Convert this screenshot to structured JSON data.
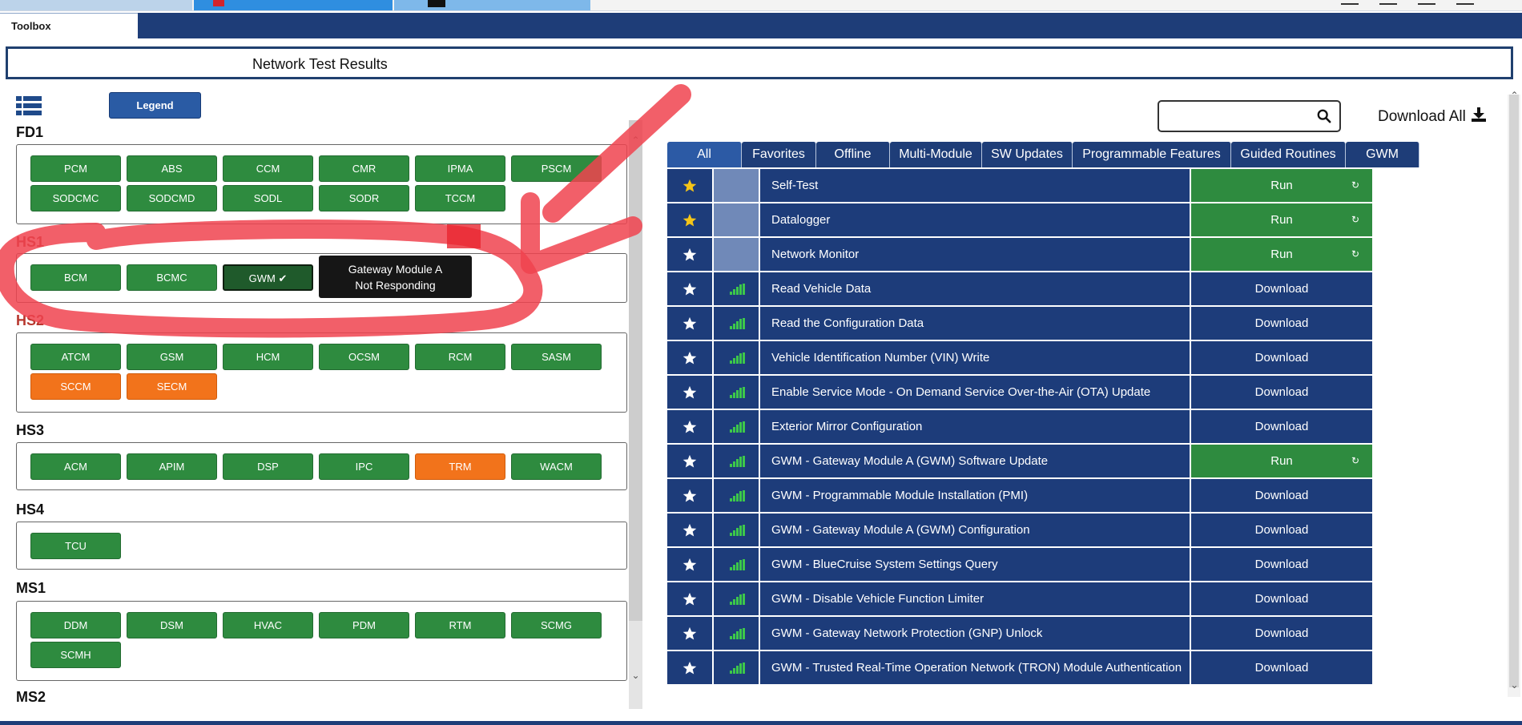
{
  "toolbar": {
    "tab_label": "Toolbox"
  },
  "title": "Network Test Results",
  "legend_button": "Legend",
  "groups": [
    {
      "label": "FD1",
      "modules": [
        {
          "name": "PCM",
          "status": "green"
        },
        {
          "name": "ABS",
          "status": "green"
        },
        {
          "name": "CCM",
          "status": "green"
        },
        {
          "name": "CMR",
          "status": "green"
        },
        {
          "name": "IPMA",
          "status": "green"
        },
        {
          "name": "PSCM",
          "status": "green"
        },
        {
          "name": "SODCMC",
          "status": "green"
        },
        {
          "name": "SODCMD",
          "status": "green"
        },
        {
          "name": "SODL",
          "status": "green"
        },
        {
          "name": "SODR",
          "status": "green"
        },
        {
          "name": "TCCM",
          "status": "green"
        }
      ]
    },
    {
      "label": "HS1",
      "modules": [
        {
          "name": "BCM",
          "status": "green"
        },
        {
          "name": "BCMC",
          "status": "green"
        },
        {
          "name": "GWM",
          "status": "selected"
        }
      ]
    },
    {
      "label": "HS2",
      "modules": [
        {
          "name": "ATCM",
          "status": "green"
        },
        {
          "name": "GSM",
          "status": "green"
        },
        {
          "name": "HCM",
          "status": "green"
        },
        {
          "name": "OCSM",
          "status": "green"
        },
        {
          "name": "RCM",
          "status": "green"
        },
        {
          "name": "SASM",
          "status": "green"
        },
        {
          "name": "SCCM",
          "status": "orange"
        },
        {
          "name": "SECM",
          "status": "orange"
        }
      ]
    },
    {
      "label": "HS3",
      "modules": [
        {
          "name": "ACM",
          "status": "green"
        },
        {
          "name": "APIM",
          "status": "green"
        },
        {
          "name": "DSP",
          "status": "green"
        },
        {
          "name": "IPC",
          "status": "green"
        },
        {
          "name": "TRM",
          "status": "orange"
        },
        {
          "name": "WACM",
          "status": "green"
        }
      ]
    },
    {
      "label": "HS4",
      "modules": [
        {
          "name": "TCU",
          "status": "green"
        }
      ]
    },
    {
      "label": "MS1",
      "modules": [
        {
          "name": "DDM",
          "status": "green"
        },
        {
          "name": "DSM",
          "status": "green"
        },
        {
          "name": "HVAC",
          "status": "green"
        },
        {
          "name": "PDM",
          "status": "green"
        },
        {
          "name": "RTM",
          "status": "green"
        },
        {
          "name": "SCMG",
          "status": "green"
        },
        {
          "name": "SCMH",
          "status": "green"
        }
      ]
    },
    {
      "label": "MS2",
      "modules": []
    }
  ],
  "tooltip": {
    "line1": "Gateway Module A",
    "line2": "Not Responding"
  },
  "download_all": "Download All",
  "tabs": [
    "All",
    "Favorites",
    "Offline",
    "Multi-Module",
    "SW Updates",
    "Programmable Features",
    "Guided Routines",
    "GWM"
  ],
  "routines": [
    {
      "name": "Self-Test",
      "action": "Run",
      "favorite": true,
      "signal": false
    },
    {
      "name": "Datalogger",
      "action": "Run",
      "favorite": true,
      "signal": false
    },
    {
      "name": "Network Monitor",
      "action": "Run",
      "favorite": false,
      "signal": false
    },
    {
      "name": "Read Vehicle Data",
      "action": "Download",
      "favorite": false,
      "signal": true
    },
    {
      "name": "Read the Configuration Data",
      "action": "Download",
      "favorite": false,
      "signal": true
    },
    {
      "name": "Vehicle Identification Number (VIN) Write",
      "action": "Download",
      "favorite": false,
      "signal": true
    },
    {
      "name": "Enable Service Mode - On Demand Service Over-the-Air (OTA) Update",
      "action": "Download",
      "favorite": false,
      "signal": true
    },
    {
      "name": "Exterior Mirror Configuration",
      "action": "Download",
      "favorite": false,
      "signal": true
    },
    {
      "name": "GWM - Gateway Module A (GWM) Software Update",
      "action": "Run",
      "favorite": false,
      "signal": true
    },
    {
      "name": "GWM - Programmable Module Installation (PMI)",
      "action": "Download",
      "favorite": false,
      "signal": true
    },
    {
      "name": "GWM - Gateway Module A (GWM) Configuration",
      "action": "Download",
      "favorite": false,
      "signal": true
    },
    {
      "name": "GWM - BlueCruise System Settings Query",
      "action": "Download",
      "favorite": false,
      "signal": true
    },
    {
      "name": "GWM - Disable Vehicle Function Limiter",
      "action": "Download",
      "favorite": false,
      "signal": true
    },
    {
      "name": "GWM - Gateway Network Protection (GNP) Unlock",
      "action": "Download",
      "favorite": false,
      "signal": true
    },
    {
      "name": "GWM - Trusted Real-Time Operation Network (TRON) Module Authentication",
      "action": "Download",
      "favorite": false,
      "signal": true
    }
  ],
  "colors": {
    "navy": "#1e3d78",
    "module_green": "#2e8b3f",
    "module_orange": "#f2731b",
    "star_favorite": "#f5c518",
    "signal_green": "#3cc84a",
    "annotation_red": "#f0434f"
  },
  "icons": {
    "menu": "list-grid-icon",
    "search": "magnifier-icon",
    "download": "download-arrow-icon",
    "star": "star-icon",
    "signal": "signal-bars-icon",
    "cycle": "refresh-cycle-icon",
    "check": "checkmark-icon"
  }
}
